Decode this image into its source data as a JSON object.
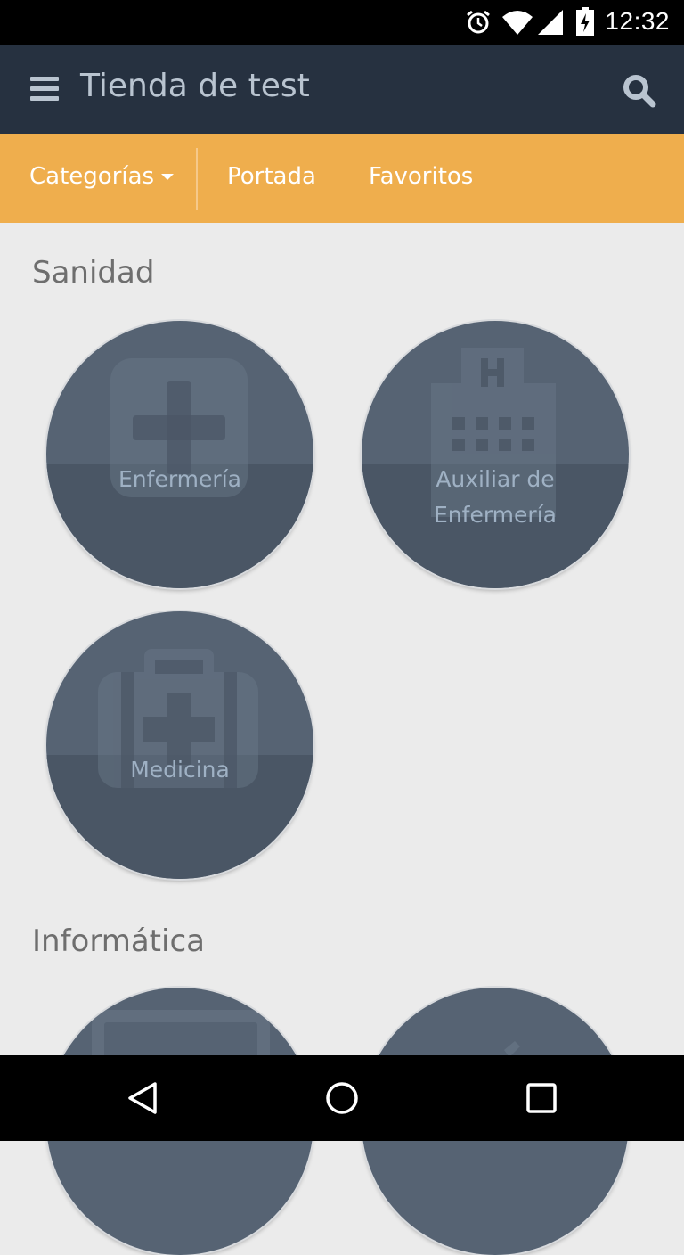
{
  "status_bar": {
    "time": "12:32"
  },
  "app_bar": {
    "title": "Tienda de test"
  },
  "nav": {
    "categories_label": "Categorías",
    "home_label": "Portada",
    "favorites_label": "Favoritos"
  },
  "sections": [
    {
      "title": "Sanidad",
      "items": [
        {
          "label_line1": "Enfermería",
          "label_line2": "",
          "icon": "medical-cross-icon"
        },
        {
          "label_line1": "Auxiliar de",
          "label_line2": "Enfermería",
          "icon": "hospital-building-icon"
        },
        {
          "label_line1": "Medicina",
          "label_line2": "",
          "icon": "medical-kit-icon"
        }
      ]
    },
    {
      "title": "Informática",
      "items": [
        {
          "label_line1": "",
          "label_line2": "",
          "icon": "monitor-icon"
        },
        {
          "label_line1": "",
          "label_line2": "",
          "icon": "pencil-icon"
        }
      ]
    }
  ],
  "colors": {
    "app_bar": "#263140",
    "nav_bar": "#efae4d",
    "background": "#ebebeb",
    "circle": "#566373"
  }
}
